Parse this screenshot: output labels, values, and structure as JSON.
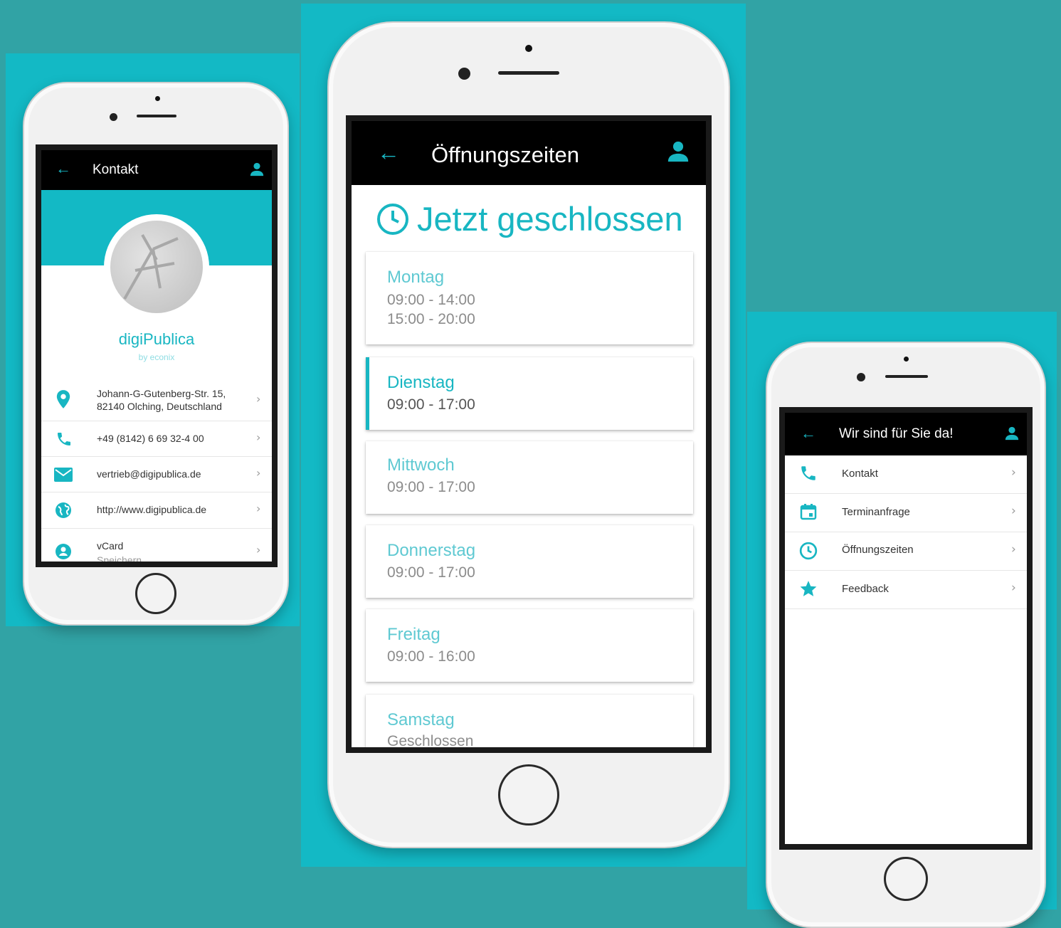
{
  "colors": {
    "accent": "#18b6c2",
    "background": "#31a3a5",
    "panel": "#13b9c5",
    "appbar": "#000000"
  },
  "phone_left": {
    "appbar": {
      "title": "Kontakt"
    },
    "profile": {
      "name": "digiPublica",
      "subtitle": "by econix"
    },
    "rows": [
      {
        "icon": "location-pin-icon",
        "line1": "Johann-G-Gutenberg-Str. 15,",
        "line2": "82140 Olching, Deutschland"
      },
      {
        "icon": "phone-icon",
        "line1": "+49 (8142) 6 69 32-4 00"
      },
      {
        "icon": "mail-icon",
        "line1": "vertrieb@digipublica.de"
      },
      {
        "icon": "globe-icon",
        "line1": "http://www.digipublica.de"
      },
      {
        "icon": "account-icon",
        "line1": "vCard",
        "line2": "Speichern"
      }
    ]
  },
  "phone_center": {
    "appbar": {
      "title": "Öffnungszeiten"
    },
    "status": "Jetzt geschlossen",
    "days": [
      {
        "day": "Montag",
        "times": [
          "09:00 - 14:00",
          "15:00 - 20:00"
        ]
      },
      {
        "day": "Dienstag",
        "times": [
          "09:00 - 17:00"
        ]
      },
      {
        "day": "Mittwoch",
        "times": [
          "09:00 - 17:00"
        ]
      },
      {
        "day": "Donnerstag",
        "times": [
          "09:00 - 17:00"
        ]
      },
      {
        "day": "Freitag",
        "times": [
          "09:00 - 16:00"
        ]
      },
      {
        "day": "Samstag",
        "times": [
          "Geschlossen"
        ]
      }
    ]
  },
  "phone_right": {
    "appbar": {
      "title": "Wir sind für Sie da!"
    },
    "menu": [
      {
        "icon": "phone-icon",
        "label": "Kontakt"
      },
      {
        "icon": "calendar-icon",
        "label": "Terminanfrage"
      },
      {
        "icon": "clock-icon",
        "label": "Öffnungszeiten"
      },
      {
        "icon": "star-icon",
        "label": "Feedback"
      }
    ]
  }
}
